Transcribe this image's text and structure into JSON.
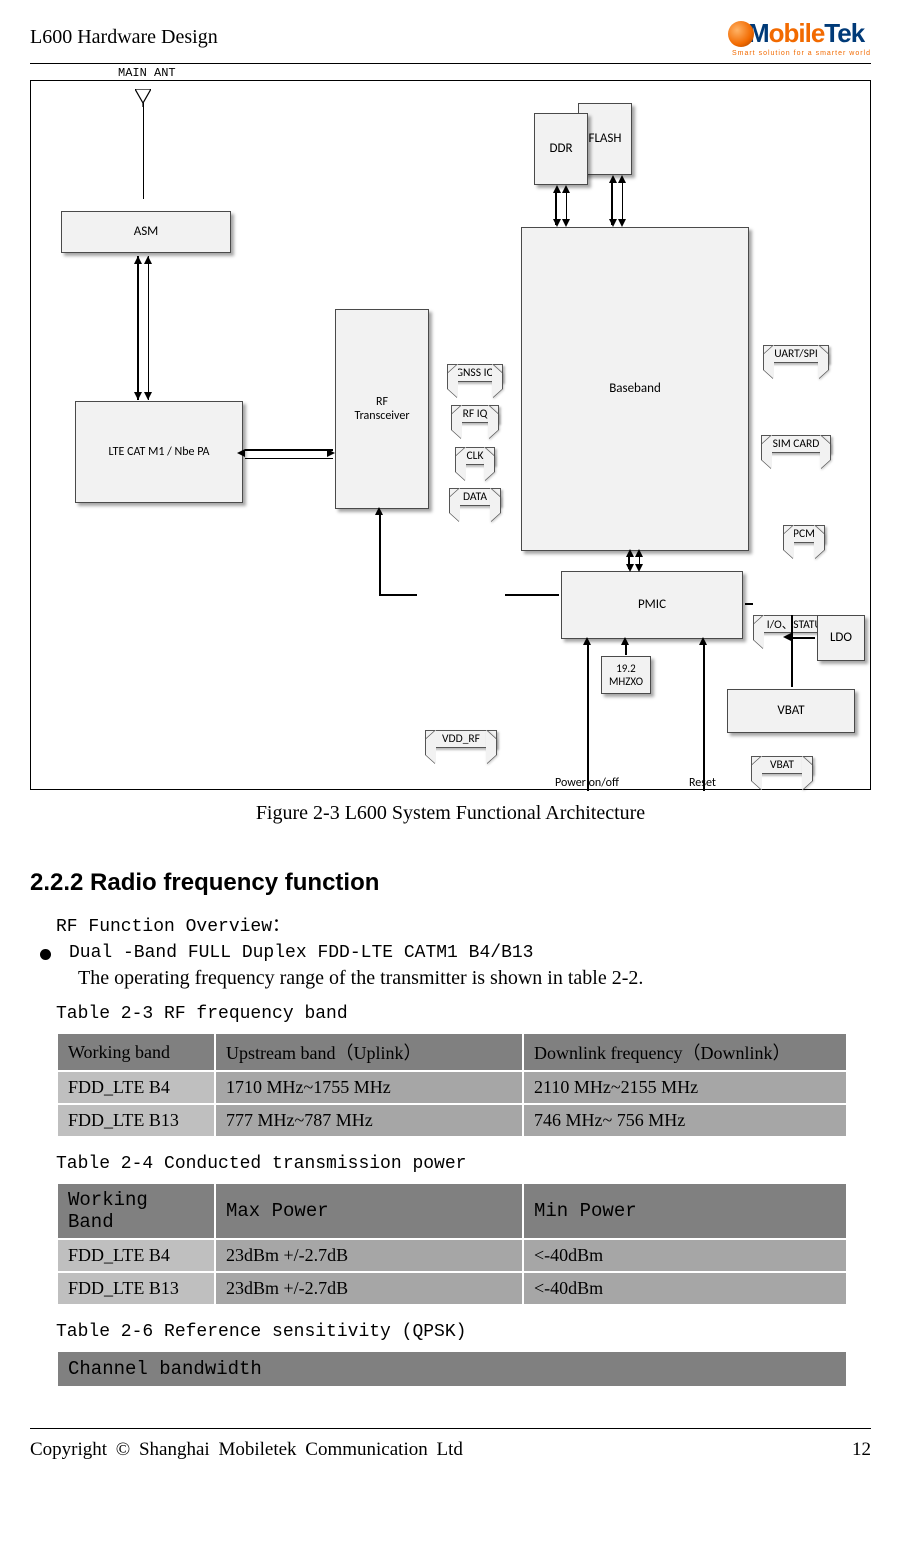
{
  "header": {
    "title": "L600 Hardware Design",
    "logo_text_pre": "M",
    "logo_text_mid": "obile",
    "logo_text_post": "Tek",
    "tagline": "Smart solution for a smarter world"
  },
  "diagram": {
    "ant": "MAIN ANT",
    "blocks": {
      "asm": "ASM",
      "pa": "LTE CAT M1 / Nbe PA",
      "rf": "RF\nTransceiver",
      "ddr": "DDR",
      "flash": "FLASH",
      "baseband": "Baseband",
      "pmic": "PMIC",
      "xo": "19.2\nMHZXO",
      "ldo": "LDO",
      "vbat2": "VBAT"
    },
    "signals": {
      "gnss": "GNSS IQ",
      "rfiq": "RF IQ",
      "clk": "CLK",
      "data": "DATA",
      "vddrf": "VDD_RF",
      "vbat1": "VBAT",
      "uart": "UART/SPI",
      "sim": "SIM CARD",
      "pcm": "PCM",
      "iost": "I/O、STATUS"
    },
    "labels": {
      "pwr": "Power on/off",
      "rst": "Reset"
    }
  },
  "figcap": "Figure 2-3 L600 System Functional Architecture",
  "section_title": "2.2.2 Radio frequency function",
  "rf_overview": "RF Function Overview：",
  "bullet1": "Dual -Band FULL Duplex FDD-LTE CATM1 B4/B13",
  "freq_note": "The operating frequency range of the transmitter is shown in table 2-2.",
  "tbl23_label": "Table 2-3 RF frequency band",
  "tbl23": {
    "h1": "Working band",
    "h2": "Upstream band（Uplink）",
    "h3": "Downlink frequency（Downlink）",
    "rows": [
      {
        "c1": "FDD_LTE B4",
        "c2": "1710 MHz~1755 MHz",
        "c3": "2110 MHz~2155 MHz"
      },
      {
        "c1": "FDD_LTE B13",
        "c2": "777 MHz~787 MHz",
        "c3": "746 MHz~ 756 MHz"
      }
    ]
  },
  "tbl24_label": "Table 2-4 Conducted transmission power",
  "tbl24": {
    "h1": "Working Band",
    "h2": "Max Power",
    "h3": "Min Power",
    "rows": [
      {
        "c1": "FDD_LTE B4",
        "c2": "23dBm +/-2.7dB",
        "c3": "<-40dBm"
      },
      {
        "c1": "FDD_LTE B13",
        "c2": "23dBm +/-2.7dB",
        "c3": "<-40dBm"
      }
    ]
  },
  "tbl26_label": "Table 2-6 Reference sensitivity (QPSK)",
  "tbl26_h1": "Channel bandwidth",
  "footer": {
    "left": "Copyright  ©  Shanghai  Mobiletek  Communication  Ltd",
    "right": "12"
  }
}
